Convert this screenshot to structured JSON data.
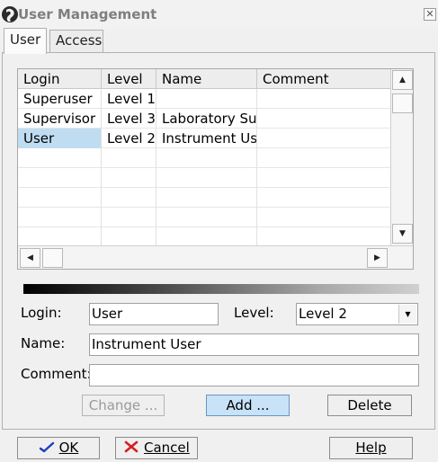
{
  "window": {
    "title": "User Management",
    "close_glyph": "✕"
  },
  "tabs": [
    {
      "label": "User",
      "active": true
    },
    {
      "label": "Access",
      "active": false
    }
  ],
  "grid": {
    "columns": [
      "Login",
      "Level",
      "Name",
      "Comment"
    ],
    "rows": [
      {
        "login": "Superuser",
        "level": "Level  1",
        "name": "",
        "comment": "",
        "selected": false
      },
      {
        "login": "Supervisor",
        "level": "Level  3",
        "name": "Laboratory Supervisor",
        "comment": "",
        "selected": false
      },
      {
        "login": "User",
        "level": "Level  2",
        "name": "Instrument User",
        "comment": "",
        "selected": true
      }
    ],
    "scroll_up_glyph": "▲",
    "scroll_down_glyph": "▼",
    "scroll_left_glyph": "◀",
    "scroll_right_glyph": "▶"
  },
  "form": {
    "login_label": "Login:",
    "login_value": "User",
    "level_label": "Level:",
    "level_value": "Level  2",
    "level_arrow": "▼",
    "name_label": "Name:",
    "name_value": "Instrument User",
    "comment_label": "Comment:",
    "comment_value": ""
  },
  "actions": {
    "change_label": "Change ...",
    "add_label": "Add ...",
    "delete_label": "Delete"
  },
  "footer": {
    "ok_label": "OK",
    "cancel_label": "Cancel",
    "help_label": "Help"
  },
  "colors": {
    "selection": "#bfdcf0",
    "ok_check": "#1f3fbf",
    "cancel_x": "#d42020"
  }
}
